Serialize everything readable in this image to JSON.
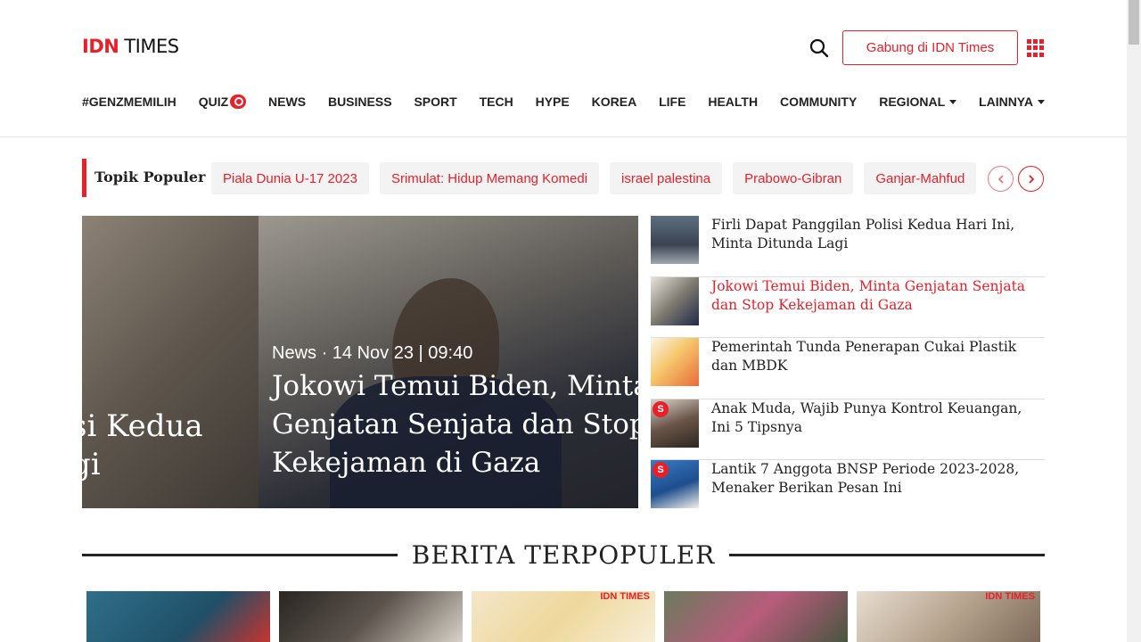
{
  "header": {
    "logo_idn": "IDN",
    "logo_times": "TIMES",
    "join_label": "Gabung di IDN Times"
  },
  "nav": [
    {
      "label": "#GENZMEMILIH"
    },
    {
      "label": "QUIZ"
    },
    {
      "label": "NEWS"
    },
    {
      "label": "BUSINESS"
    },
    {
      "label": "SPORT"
    },
    {
      "label": "TECH"
    },
    {
      "label": "HYPE"
    },
    {
      "label": "KOREA"
    },
    {
      "label": "LIFE"
    },
    {
      "label": "HEALTH"
    },
    {
      "label": "COMMUNITY"
    },
    {
      "label": "REGIONAL"
    },
    {
      "label": "LAINNYA"
    }
  ],
  "topik": {
    "title": "Topik Populer",
    "chips": [
      "Piala Dunia U-17 2023",
      "Srimulat: Hidup Memang Komedi",
      "israel palestina",
      "Prabowo-Gibran",
      "Ganjar-Mahfud"
    ]
  },
  "hero": {
    "ghost_line1": "si Kedua",
    "ghost_line2": "gi",
    "category": "News",
    "date": "· 14 Nov 23 | 09:40",
    "title_line1": "Jokowi Temui Biden, Minta",
    "title_line2": "Genjatan Senjata dan Stop",
    "title_line3": "Kekejaman di Gaza"
  },
  "side_list": [
    {
      "title": "Firli Dapat Panggilan Polisi Kedua Hari Ini, Minta Ditunda Lagi"
    },
    {
      "title": "Jokowi Temui Biden, Minta Genjatan Senjata dan Stop Kekejaman di Gaza"
    },
    {
      "title": "Pemerintah Tunda Penerapan Cukai Plastik dan MBDK"
    },
    {
      "title": "Anak Muda, Wajib Punya Kontrol Keuangan, Ini 5 Tipsnya",
      "badge": "S"
    },
    {
      "title": "Lantik 7 Anggota BNSP Periode 2023-2028, Menaker Berikan Pesan Ini",
      "badge": "S"
    }
  ],
  "section": {
    "title": "BERITA TERPOPULER"
  },
  "cards": [
    {
      "tag": ""
    },
    {
      "tag": ""
    },
    {
      "tag": "IDN TIMES"
    },
    {
      "tag": ""
    },
    {
      "tag": "IDN TIMES"
    }
  ],
  "colors": {
    "accent": "#e8202a",
    "text": "#222222",
    "chip_bg": "#f3f3f3"
  }
}
